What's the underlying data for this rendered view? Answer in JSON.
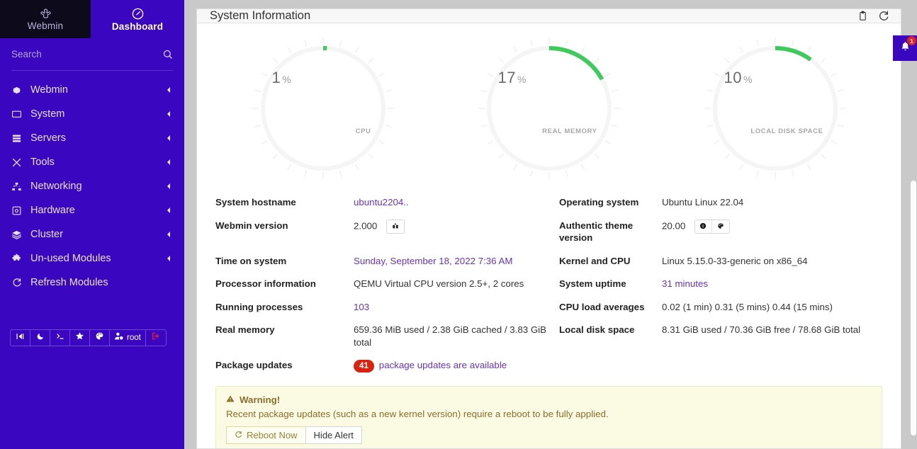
{
  "sidebar": {
    "brand_tabs": [
      {
        "label": "Webmin",
        "icon": "webmin-logo-icon",
        "active": false
      },
      {
        "label": "Dashboard",
        "icon": "dashboard-gauge-icon",
        "active": true
      }
    ],
    "search": {
      "placeholder": "Search",
      "value": "",
      "icon": "search-icon"
    },
    "items": [
      {
        "label": "Webmin",
        "icon": "gear-icon",
        "caret": "chevron-left-icon"
      },
      {
        "label": "System",
        "icon": "monitor-icon",
        "caret": "chevron-left-icon"
      },
      {
        "label": "Servers",
        "icon": "server-rack-icon",
        "caret": "chevron-left-icon"
      },
      {
        "label": "Tools",
        "icon": "crossed-tools-icon",
        "caret": "chevron-left-icon"
      },
      {
        "label": "Networking",
        "icon": "network-tree-icon",
        "caret": "chevron-left-icon"
      },
      {
        "label": "Hardware",
        "icon": "hard-drive-icon",
        "caret": "chevron-left-icon"
      },
      {
        "label": "Cluster",
        "icon": "layers-icon",
        "caret": "chevron-left-icon"
      },
      {
        "label": "Un-used Modules",
        "icon": "puzzle-piece-icon",
        "caret": "chevron-left-icon"
      },
      {
        "label": "Refresh Modules",
        "icon": "refresh-icon",
        "caret": ""
      }
    ],
    "bottom_bar": [
      {
        "name": "collapse-sidebar-button",
        "icon": "collapse-icon",
        "text": ""
      },
      {
        "name": "dark-mode-button",
        "icon": "moon-icon",
        "text": ""
      },
      {
        "name": "terminal-button",
        "icon": "terminal-icon",
        "text": ""
      },
      {
        "name": "favorites-button",
        "icon": "star-icon",
        "text": ""
      },
      {
        "name": "theme-palette-button",
        "icon": "palette-icon",
        "text": ""
      },
      {
        "name": "user-account-button",
        "icon": "user-gear-icon",
        "text": "root"
      },
      {
        "name": "logout-button",
        "icon": "logout-arrow-icon",
        "text": ""
      }
    ]
  },
  "panel": {
    "title": "System Information",
    "actions": [
      {
        "name": "copy-to-clipboard-button",
        "icon": "clipboard-icon"
      },
      {
        "name": "refresh-page-button",
        "icon": "refresh-icon"
      }
    ]
  },
  "notification": {
    "icon": "bell-icon",
    "count": "1"
  },
  "chart_data": [
    {
      "type": "gauge",
      "title": "CPU",
      "value": 1,
      "display_value": "1",
      "unit": "%",
      "range": [
        0,
        100
      ],
      "arc_color": "#3ecb5c",
      "track_color": "#f4f4f4",
      "ticks": 24
    },
    {
      "type": "gauge",
      "title": "REAL MEMORY",
      "value": 17,
      "display_value": "17",
      "unit": "%",
      "range": [
        0,
        100
      ],
      "arc_color": "#3ecb5c",
      "track_color": "#f4f4f4",
      "ticks": 24
    },
    {
      "type": "gauge",
      "title": "LOCAL DISK SPACE",
      "value": 10,
      "display_value": "10",
      "unit": "%",
      "range": [
        0,
        100
      ],
      "arc_color": "#3ecb5c",
      "track_color": "#f4f4f4",
      "ticks": 24
    }
  ],
  "info": {
    "rows": [
      {
        "left_label": "System hostname",
        "left_value": "ubuntu2204..",
        "left_link": true,
        "right_label": "Operating system",
        "right_value": "Ubuntu Linux 22.04",
        "right_link": false
      },
      {
        "left_label": "Webmin version",
        "left_value": "2.000",
        "left_link": false,
        "left_buttons": [
          {
            "name": "webmin-package-button",
            "icon": "package-icon"
          }
        ],
        "right_label": "Authentic theme version",
        "right_value": "20.00",
        "right_link": false,
        "right_buttons": [
          {
            "name": "theme-info-button",
            "icon": "info-circle-icon"
          },
          {
            "name": "theme-palette-button",
            "icon": "palette-icon"
          }
        ]
      },
      {
        "left_label": "Time on system",
        "left_value": "Sunday, September 18, 2022 7:36 AM",
        "left_link": true,
        "right_label": "Kernel and CPU",
        "right_value": "Linux 5.15.0-33-generic on x86_64",
        "right_link": false
      },
      {
        "left_label": "Processor information",
        "left_value": "QEMU Virtual CPU version 2.5+, 2 cores",
        "left_link": false,
        "right_label": "System uptime",
        "right_value": "31 minutes",
        "right_link": true
      },
      {
        "left_label": "Running processes",
        "left_value": "103",
        "left_link": true,
        "right_label": "CPU load averages",
        "right_value": "0.02 (1 min) 0.31 (5 mins) 0.44 (15 mins)",
        "right_link": false
      },
      {
        "left_label": "Real memory",
        "left_value": "659.36 MiB used / 2.38 GiB cached / 3.83 GiB total",
        "left_link": false,
        "right_label": "Local disk space",
        "right_value": "8.31 GiB used / 70.36 GiB free / 78.68 GiB total",
        "right_link": false
      }
    ],
    "package_updates": {
      "label": "Package updates",
      "badge": "41",
      "link_text": "package updates are available"
    }
  },
  "warning": {
    "icon": "warning-triangle-icon",
    "title": "Warning!",
    "text": "Recent package updates (such as a new kernel version) require a reboot to be fully applied.",
    "reboot_label": "Reboot Now",
    "reboot_icon": "refresh-icon",
    "hide_label": "Hide Alert"
  },
  "colors": {
    "sidebar": "#3a06c0",
    "brand_tab_inactive": "#0d0a1c",
    "link": "#6633cc",
    "gauge_arc": "#3ecb5c",
    "badge_red": "#d9220f",
    "warning_bg": "#fbfbe4",
    "warning_text": "#8a6d2b"
  }
}
